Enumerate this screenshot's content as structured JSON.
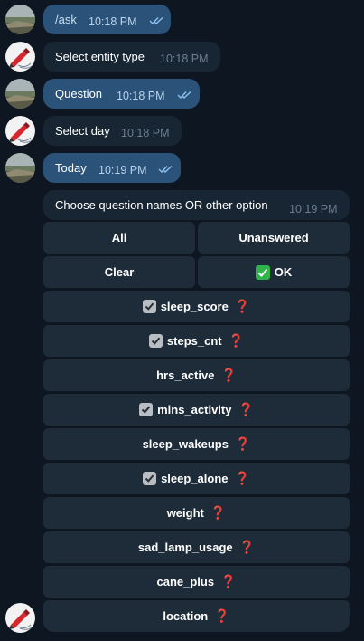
{
  "colors": {
    "background": "#0e1621",
    "outgoing_bubble": "#2b5278",
    "incoming_bubble": "#182533",
    "keyboard_button": "#1e2c3a",
    "question_mark": "#e0303a",
    "ok_check": "#2fb34a"
  },
  "messages": [
    {
      "direction": "outgoing",
      "text": "/ask",
      "time": "10:18 PM",
      "read": true
    },
    {
      "direction": "incoming",
      "text": "Select entity type",
      "time": "10:18 PM"
    },
    {
      "direction": "outgoing",
      "text": "Question",
      "time": "10:18 PM",
      "read": true
    },
    {
      "direction": "incoming",
      "text": "Select day",
      "time": "10:18 PM"
    },
    {
      "direction": "outgoing",
      "text": "Today",
      "time": "10:19 PM",
      "read": true
    },
    {
      "direction": "incoming",
      "text": "Choose question names OR other option",
      "time": "10:19 PM"
    }
  ],
  "keyboard": {
    "all_label": "All",
    "unanswered_label": "Unanswered",
    "clear_label": "Clear",
    "ok_label": "OK",
    "ok_icon": "green-check-mark-icon",
    "question_icon": "red-question-mark-icon",
    "question_glyph": "❓",
    "items": [
      {
        "label": "sleep_score",
        "checked": true
      },
      {
        "label": "steps_cnt",
        "checked": true
      },
      {
        "label": "hrs_active",
        "checked": false
      },
      {
        "label": "mins_activity",
        "checked": true
      },
      {
        "label": "sleep_wakeups",
        "checked": false
      },
      {
        "label": "sleep_alone",
        "checked": true
      },
      {
        "label": "weight",
        "checked": false
      },
      {
        "label": "sad_lamp_usage",
        "checked": false
      },
      {
        "label": "cane_plus",
        "checked": false
      },
      {
        "label": "location",
        "checked": false
      }
    ]
  }
}
